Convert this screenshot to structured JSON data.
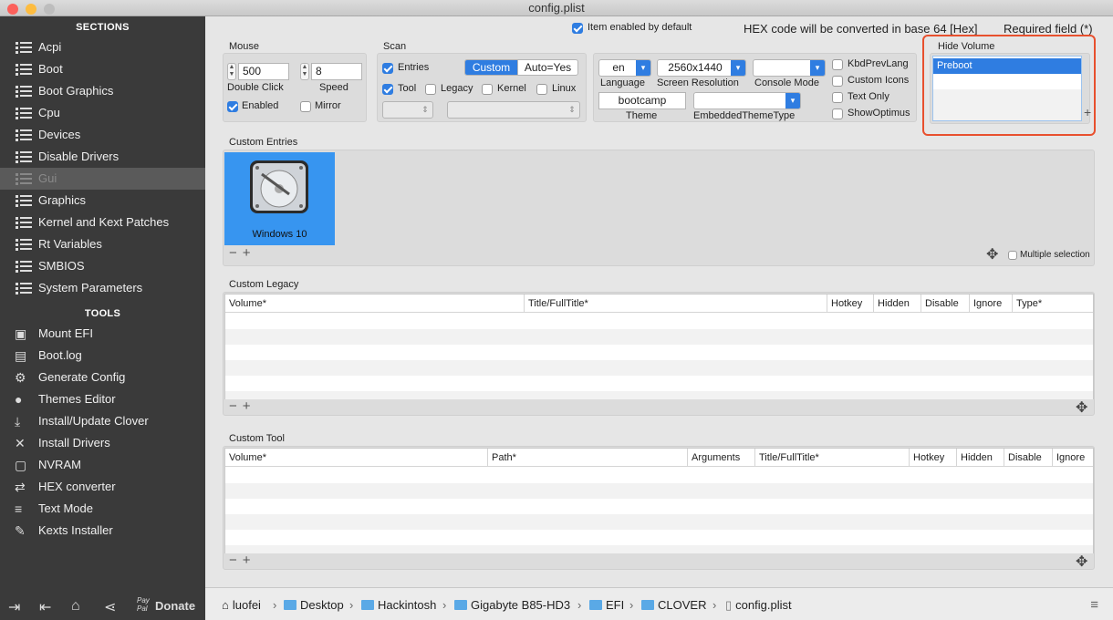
{
  "window": {
    "title": "config.plist"
  },
  "sidebar": {
    "sections_header": "SECTIONS",
    "sections": [
      "Acpi",
      "Boot",
      "Boot Graphics",
      "Cpu",
      "Devices",
      "Disable Drivers",
      "Gui",
      "Graphics",
      "Kernel and Kext Patches",
      "Rt Variables",
      "SMBIOS",
      "System Parameters"
    ],
    "active_section": "Gui",
    "tools_header": "TOOLS",
    "tools": [
      {
        "label": "Mount EFI",
        "icon": "disk-icon"
      },
      {
        "label": "Boot.log",
        "icon": "log-search-icon"
      },
      {
        "label": "Generate Config",
        "icon": "gears-icon"
      },
      {
        "label": "Themes Editor",
        "icon": "palette-icon"
      },
      {
        "label": "Install/Update Clover",
        "icon": "download-icon"
      },
      {
        "label": "Install Drivers",
        "icon": "tools-icon"
      },
      {
        "label": "NVRAM",
        "icon": "chip-icon"
      },
      {
        "label": "HEX converter",
        "icon": "swap-icon"
      },
      {
        "label": "Text Mode",
        "icon": "text-lines-icon"
      },
      {
        "label": "Kexts Installer",
        "icon": "wrench-icon"
      }
    ],
    "donate_label": "Donate",
    "paypal_label": "Pay Pal"
  },
  "header": {
    "item_enabled_default": "Item enabled by default",
    "hex_note": "HEX code will be converted in base 64 [Hex]",
    "required_note": "Required field (*)"
  },
  "mouse": {
    "title": "Mouse",
    "double_click_value": "500",
    "double_click_label": "Double Click",
    "speed_value": "8",
    "speed_label": "Speed",
    "enabled_label": "Enabled",
    "enabled": true,
    "mirror_label": "Mirror",
    "mirror": false
  },
  "scan": {
    "title": "Scan",
    "entries_label": "Entries",
    "entries": true,
    "segment_options": [
      "Custom",
      "Auto=Yes"
    ],
    "segment_selected": "Custom",
    "tool_label": "Tool",
    "tool": true,
    "legacy_label": "Legacy",
    "kernel_label": "Kernel",
    "linux_label": "Linux"
  },
  "display": {
    "language_value": "en",
    "language_label": "Language",
    "resolution_value": "2560x1440",
    "resolution_label": "Screen Resolution",
    "console_value": "",
    "console_label": "Console Mode",
    "theme_value": "bootcamp",
    "theme_label": "Theme",
    "embedded_theme_value": "",
    "embedded_theme_label": "EmbeddedThemeType",
    "kbd_prev_lang": "KbdPrevLang",
    "custom_icons": "Custom Icons",
    "text_only": "Text Only",
    "show_optimus": "ShowOptimus"
  },
  "hide_volume": {
    "title": "Hide Volume",
    "items": [
      "Preboot"
    ]
  },
  "custom_entries": {
    "title": "Custom Entries",
    "entries": [
      {
        "label": "Windows 10",
        "icon": "hard-drive-icon"
      }
    ],
    "multiple_selection_label": "Multiple selection"
  },
  "custom_legacy": {
    "title": "Custom Legacy",
    "columns": [
      "Volume*",
      "Title/FullTitle*",
      "Hotkey",
      "Hidden",
      "Disable",
      "Ignore",
      "Type*"
    ]
  },
  "custom_tool": {
    "title": "Custom Tool",
    "columns": [
      "Volume*",
      "Path*",
      "Arguments",
      "Title/FullTitle*",
      "Hotkey",
      "Hidden",
      "Disable",
      "Ignore"
    ]
  },
  "pathbar": {
    "crumbs": [
      "luofei",
      "Desktop",
      "Hackintosh",
      "Gigabyte B85-HD3",
      "EFI",
      "CLOVER",
      "config.plist"
    ]
  },
  "colors": {
    "accent": "#2f7de1",
    "highlight_border": "#e8502e",
    "sidebar_bg": "#3a3a3a"
  }
}
